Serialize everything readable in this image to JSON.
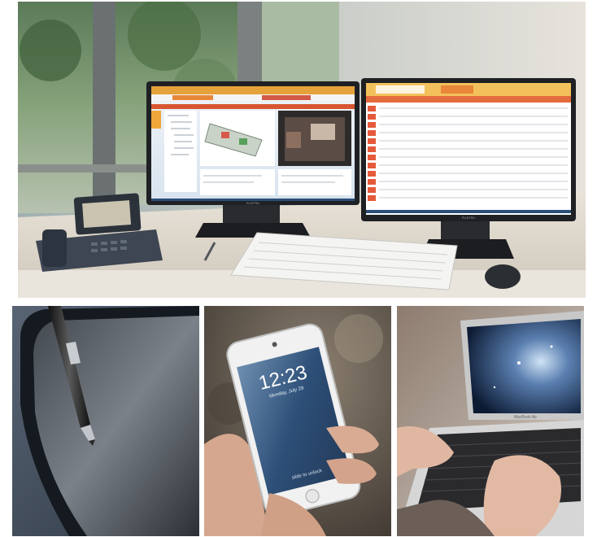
{
  "phone": {
    "time": "12:23",
    "date": "Monday, July 29",
    "unlock": "slide to unlock"
  },
  "laptop": {
    "brand": "MacBook Air"
  },
  "monitors": {
    "left_brand": "FUJITSU",
    "right_brand": "FUJITSU"
  }
}
